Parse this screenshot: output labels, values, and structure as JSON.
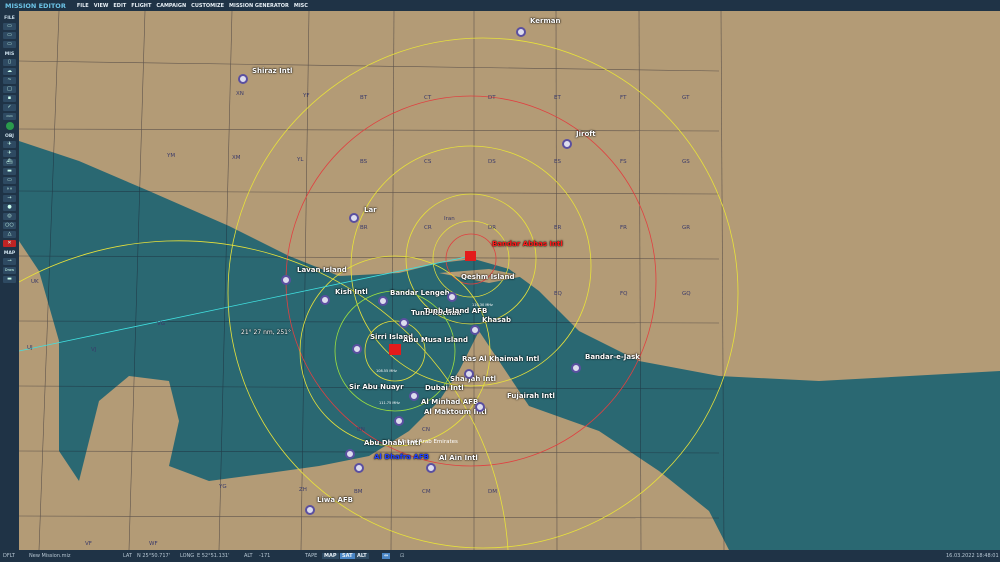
{
  "app": {
    "title": "MISSION EDITOR"
  },
  "menu": [
    "FILE",
    "VIEW",
    "EDIT",
    "FLIGHT",
    "CAMPAIGN",
    "CUSTOMIZE",
    "MISSION GENERATOR",
    "MISC"
  ],
  "toolbar": {
    "sections": {
      "file": "FILE",
      "mis": "MIS",
      "obj": "OBJ",
      "map": "MAP"
    },
    "buttons": {
      "draw": "Draw"
    }
  },
  "map": {
    "airports": [
      {
        "name": "Kerman"
      },
      {
        "name": "Shiraz Intl"
      },
      {
        "name": "Jiroft"
      },
      {
        "name": "Lar"
      },
      {
        "name": "Lavan Island"
      },
      {
        "name": "Kish Intl"
      },
      {
        "name": "Bandar Lengeh"
      },
      {
        "name": "Bandar Abbas Intl"
      },
      {
        "name": "Qeshm Island"
      },
      {
        "name": "Tunb Kochak"
      },
      {
        "name": "Tunb Island AFB"
      },
      {
        "name": "Khasab"
      },
      {
        "name": "Sirri Island"
      },
      {
        "name": "Abu Musa Island"
      },
      {
        "name": "Ras Al Khaimah Intl"
      },
      {
        "name": "Bandar-e-Jask"
      },
      {
        "name": "Sharjah Intl"
      },
      {
        "name": "Dubai Intl"
      },
      {
        "name": "Sir Abu Nuayr"
      },
      {
        "name": "Al Minhad AFB"
      },
      {
        "name": "Fujairah Intl"
      },
      {
        "name": "Al Maktoum Intl"
      },
      {
        "name": "Abu Dhabi Intl"
      },
      {
        "name": "Al Dhafra AFB"
      },
      {
        "name": "Al Ain Intl"
      },
      {
        "name": "Liwa AFB"
      }
    ],
    "countries": [
      "Iran",
      "United Arab Emirates"
    ],
    "measurement": "21°  27 nm, 251°",
    "freqs": [
      "110.30 MHz",
      "108.55 MHz",
      "111.75 MHz"
    ],
    "grid": [
      "YF",
      "BT",
      "CT",
      "DT",
      "ET",
      "FT",
      "GT",
      "XN",
      "YM",
      "XM",
      "YL",
      "BS",
      "CS",
      "DS",
      "ES",
      "FS",
      "GS",
      "BR",
      "CR",
      "DR",
      "ER",
      "FR",
      "GR",
      "UK",
      "EQ",
      "FQ",
      "GQ",
      "UJ",
      "VJ",
      "BN",
      "CN",
      "VG",
      "YG",
      "BM",
      "CM",
      "DM",
      "ZH",
      "VF",
      "WF"
    ]
  },
  "status": {
    "mode": "DFLT",
    "file": "New Mission.miz",
    "lat_label": "LAT",
    "lat": "N 25°50.717'",
    "long_label": "LONG",
    "long": "E 52°51.131'",
    "alt_label": "ALT",
    "alt": "-171",
    "tape": "TAPE",
    "map": "MAP",
    "sat": "SAT",
    "altbtn": "ALT",
    "datetime": "16.03.2022 18:48:01"
  }
}
